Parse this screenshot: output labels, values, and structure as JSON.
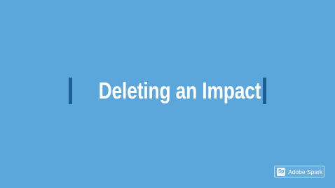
{
  "slide": {
    "title": "Deleting an Impact",
    "background_color": "#5ba7db",
    "accent_bar_color": "#1b5e96",
    "title_color": "#ffffff"
  },
  "watermark": {
    "logo_text": "Sp",
    "label": "Adobe Spark"
  }
}
